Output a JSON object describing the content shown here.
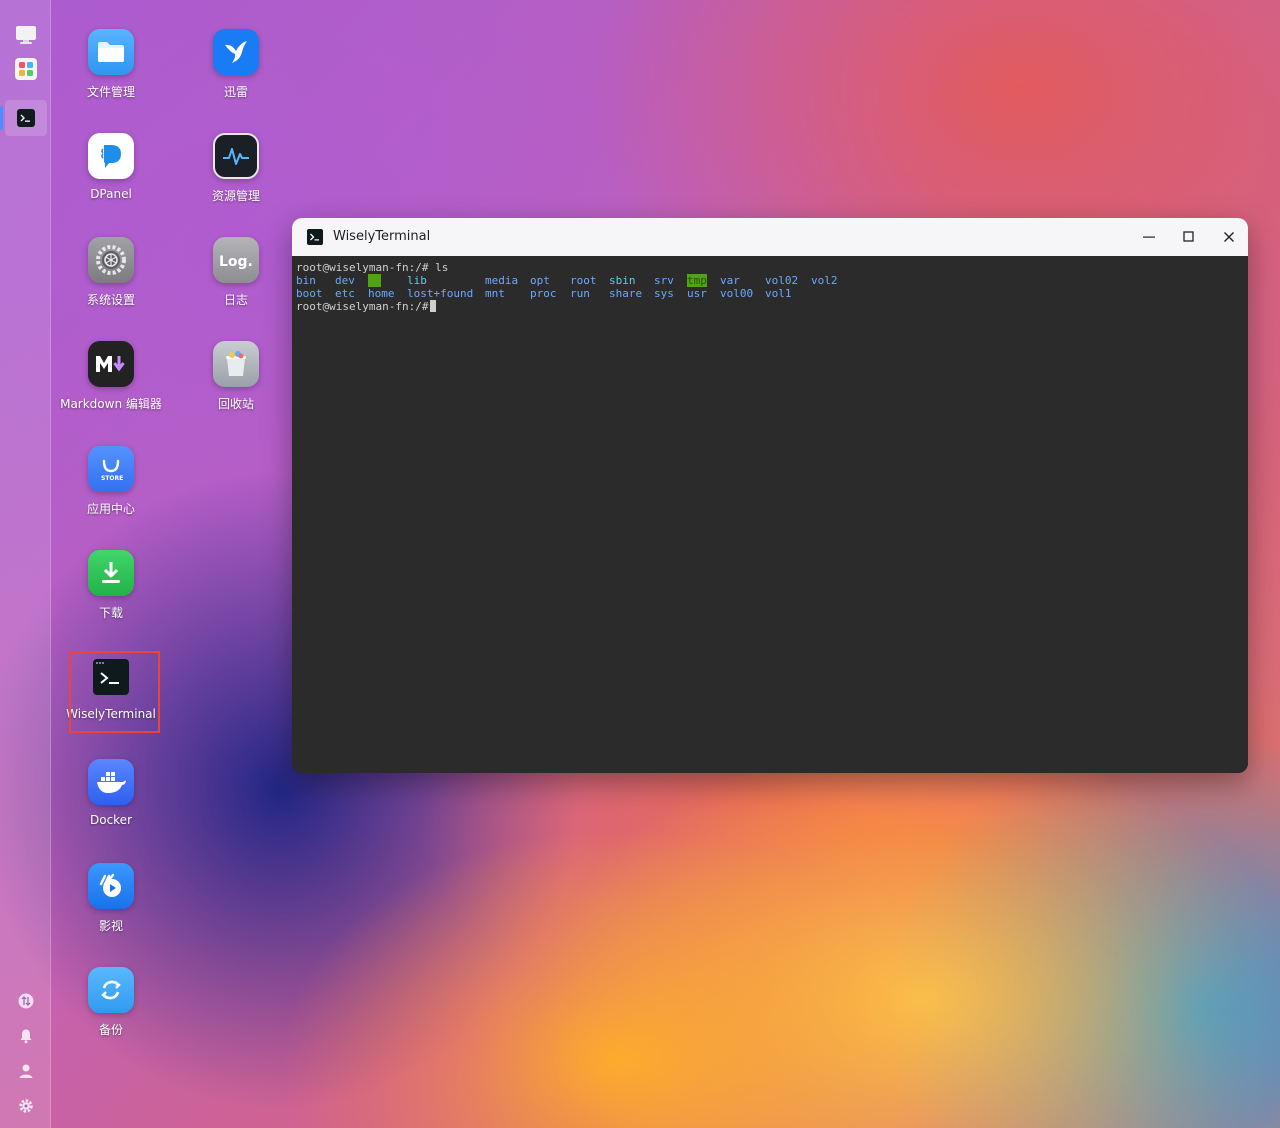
{
  "dock": {
    "top_items": [
      "desktop-icon",
      "app-grid-icon"
    ],
    "active_item": "terminal-icon",
    "bottom_items": [
      "transfer-icon",
      "bell-icon",
      "user-icon",
      "gear-icon"
    ]
  },
  "desktop": {
    "apps": [
      {
        "id": "file-manager",
        "label": "文件管理",
        "icon": "folder-icon",
        "color": "#2f96f0"
      },
      {
        "id": "xunlei",
        "label": "迅雷",
        "icon": "bird-icon",
        "color": "#1a7cf5"
      },
      {
        "id": "dpanel",
        "label": "DPanel",
        "icon": "dpanel-icon",
        "color": "#1e8ee8"
      },
      {
        "id": "resource-manager",
        "label": "资源管理",
        "icon": "activity-icon",
        "color": "#1b1f26"
      },
      {
        "id": "system-settings",
        "label": "系统设置",
        "icon": "gear-icon",
        "color": "#8b8b8e"
      },
      {
        "id": "logs",
        "label": "日志",
        "icon": "log-icon",
        "color": "#9a9a9d"
      },
      {
        "id": "markdown-editor",
        "label": "Markdown 编辑器",
        "icon": "markdown-icon",
        "color": "#222222"
      },
      {
        "id": "recycle-bin",
        "label": "回收站",
        "icon": "trash-icon",
        "color": "#aab0b8"
      },
      {
        "id": "app-center",
        "label": "应用中心",
        "icon": "store-icon",
        "color": "#3d7ff6"
      },
      {
        "id": "download",
        "label": "下载",
        "icon": "download-icon",
        "color": "#2bc253"
      },
      {
        "id": "wiselyterminal",
        "label": "WiselyTerminal",
        "icon": "terminal-icon",
        "color": "#0f1a1c"
      },
      {
        "id": "docker",
        "label": "Docker",
        "icon": "docker-icon",
        "color": "#3c6af5"
      },
      {
        "id": "video",
        "label": "影视",
        "icon": "video-icon",
        "color": "#2282f2"
      },
      {
        "id": "backup",
        "label": "备份",
        "icon": "backup-icon",
        "color": "#3aa8f2"
      }
    ]
  },
  "window": {
    "title": "WiselyTerminal",
    "controls": [
      "minimize-icon",
      "maximize-icon",
      "close-icon"
    ]
  },
  "terminal": {
    "prompt1": "root@wiselyman-fn:/# ls",
    "row1": [
      {
        "t": "bin",
        "c": "blue"
      },
      {
        "t": "dev",
        "c": "blue"
      },
      {
        "t": "  ",
        "c": "green-bg"
      },
      {
        "t": "lib",
        "c": "cyan"
      },
      {
        "t": "media",
        "c": "blue"
      },
      {
        "t": "opt",
        "c": "blue"
      },
      {
        "t": "root",
        "c": "blue"
      },
      {
        "t": "sbin",
        "c": "cyan"
      },
      {
        "t": "srv",
        "c": "blue"
      },
      {
        "t": "tmp",
        "c": "green-bg"
      },
      {
        "t": "var",
        "c": "blue"
      },
      {
        "t": "vol02",
        "c": "blue"
      },
      {
        "t": "vol2",
        "c": "blue"
      }
    ],
    "row2": [
      {
        "t": "boot",
        "c": "blue"
      },
      {
        "t": "etc",
        "c": "blue"
      },
      {
        "t": "home",
        "c": "blue"
      },
      {
        "t": "lost+found",
        "c": "blue"
      },
      {
        "t": "mnt",
        "c": "blue"
      },
      {
        "t": "proc",
        "c": "blue"
      },
      {
        "t": "run",
        "c": "blue"
      },
      {
        "t": "share",
        "c": "blue"
      },
      {
        "t": "sys",
        "c": "blue"
      },
      {
        "t": "usr",
        "c": "blue"
      },
      {
        "t": "vol00",
        "c": "blue"
      },
      {
        "t": "vol1",
        "c": "blue"
      }
    ],
    "prompt2": "root@wiselyman-fn:/#"
  },
  "colors": {
    "highlight": "#e8453c",
    "terminal_bg": "#2b2b2b",
    "dir_blue": "#6aa9ff",
    "link_cyan": "#58d3e5",
    "sticky_green": "#4fa315"
  }
}
